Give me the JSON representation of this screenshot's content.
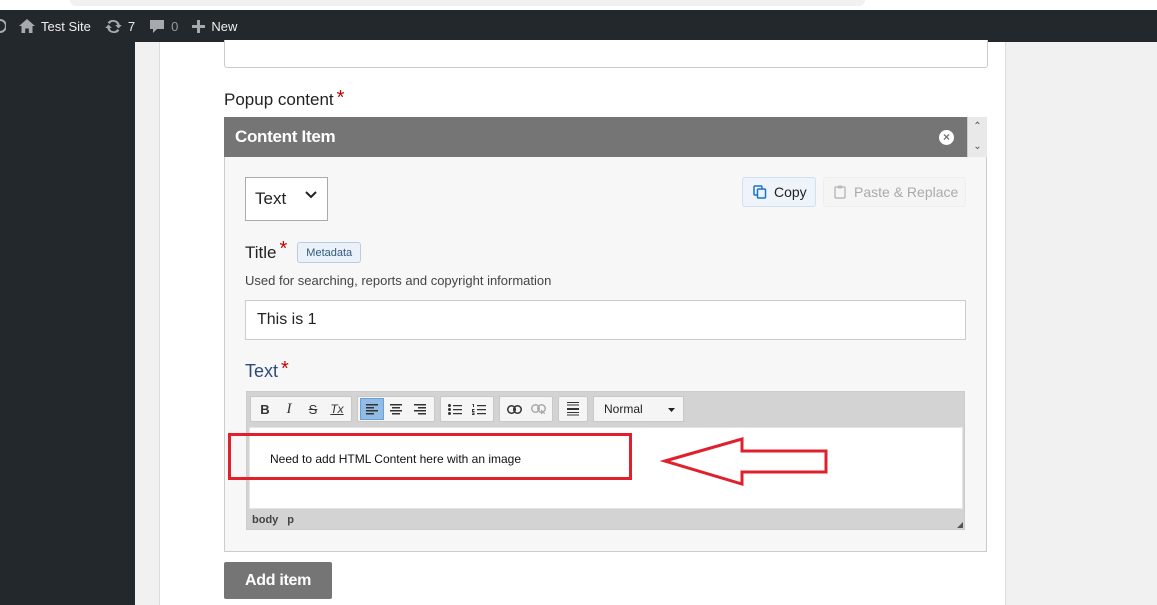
{
  "adminbar": {
    "site_name": "Test Site",
    "updates_count": "7",
    "comments_count": "0",
    "new_label": "New"
  },
  "form": {
    "popup_label": "Popup content",
    "required_mark": "*",
    "content_item": {
      "header": "Content Item",
      "close_glyph": "×",
      "up_glyph": "⌃",
      "down_glyph": "⌄",
      "type_value": "Text",
      "copy_label": "Copy",
      "paste_label": "Paste & Replace",
      "title_label": "Title",
      "metadata_badge": "Metadata",
      "helptext": "Used for searching, reports and copyright information",
      "title_value": "This is 1",
      "text_label": "Text",
      "editor": {
        "toolbar": {
          "bold": "B",
          "italic": "I",
          "strike": "S",
          "clear": "Tx",
          "format_value": "Normal"
        },
        "content": "Need to add HTML Content here with an image",
        "path": [
          "body",
          "p"
        ]
      }
    },
    "add_item_label": "Add item"
  },
  "annotation": {
    "highlight_color": "#e0202c"
  }
}
